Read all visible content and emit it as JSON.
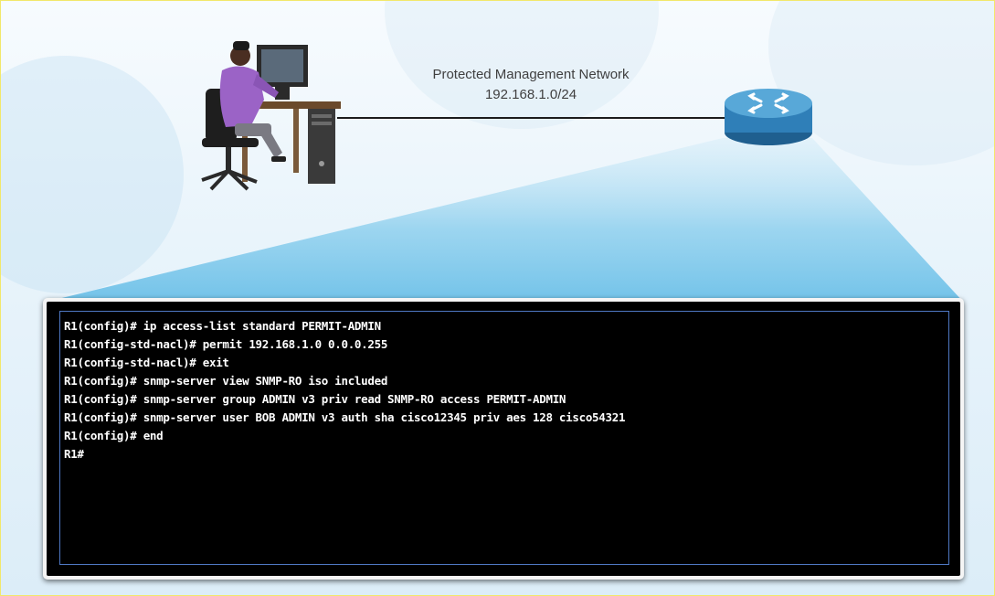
{
  "network": {
    "name": "Protected Management Network",
    "subnet": "192.168.1.0/24"
  },
  "icons": {
    "admin": "admin-workstation-icon",
    "router": "router-icon"
  },
  "colors": {
    "beam": "#7ec8ea",
    "router": "#2f7fb8",
    "terminal_border": "#4f78c4"
  },
  "terminal": {
    "lines": [
      "R1(config)# ip access-list standard PERMIT-ADMIN",
      "R1(config-std-nacl)# permit 192.168.1.0 0.0.0.255",
      "R1(config-std-nacl)# exit",
      "R1(config)# snmp-server view SNMP-RO iso included",
      "R1(config)# snmp-server group ADMIN v3 priv read SNMP-RO access PERMIT-ADMIN",
      "R1(config)# snmp-server user BOB ADMIN v3 auth sha cisco12345 priv aes 128 cisco54321",
      "R1(config)# end",
      "R1#"
    ]
  }
}
